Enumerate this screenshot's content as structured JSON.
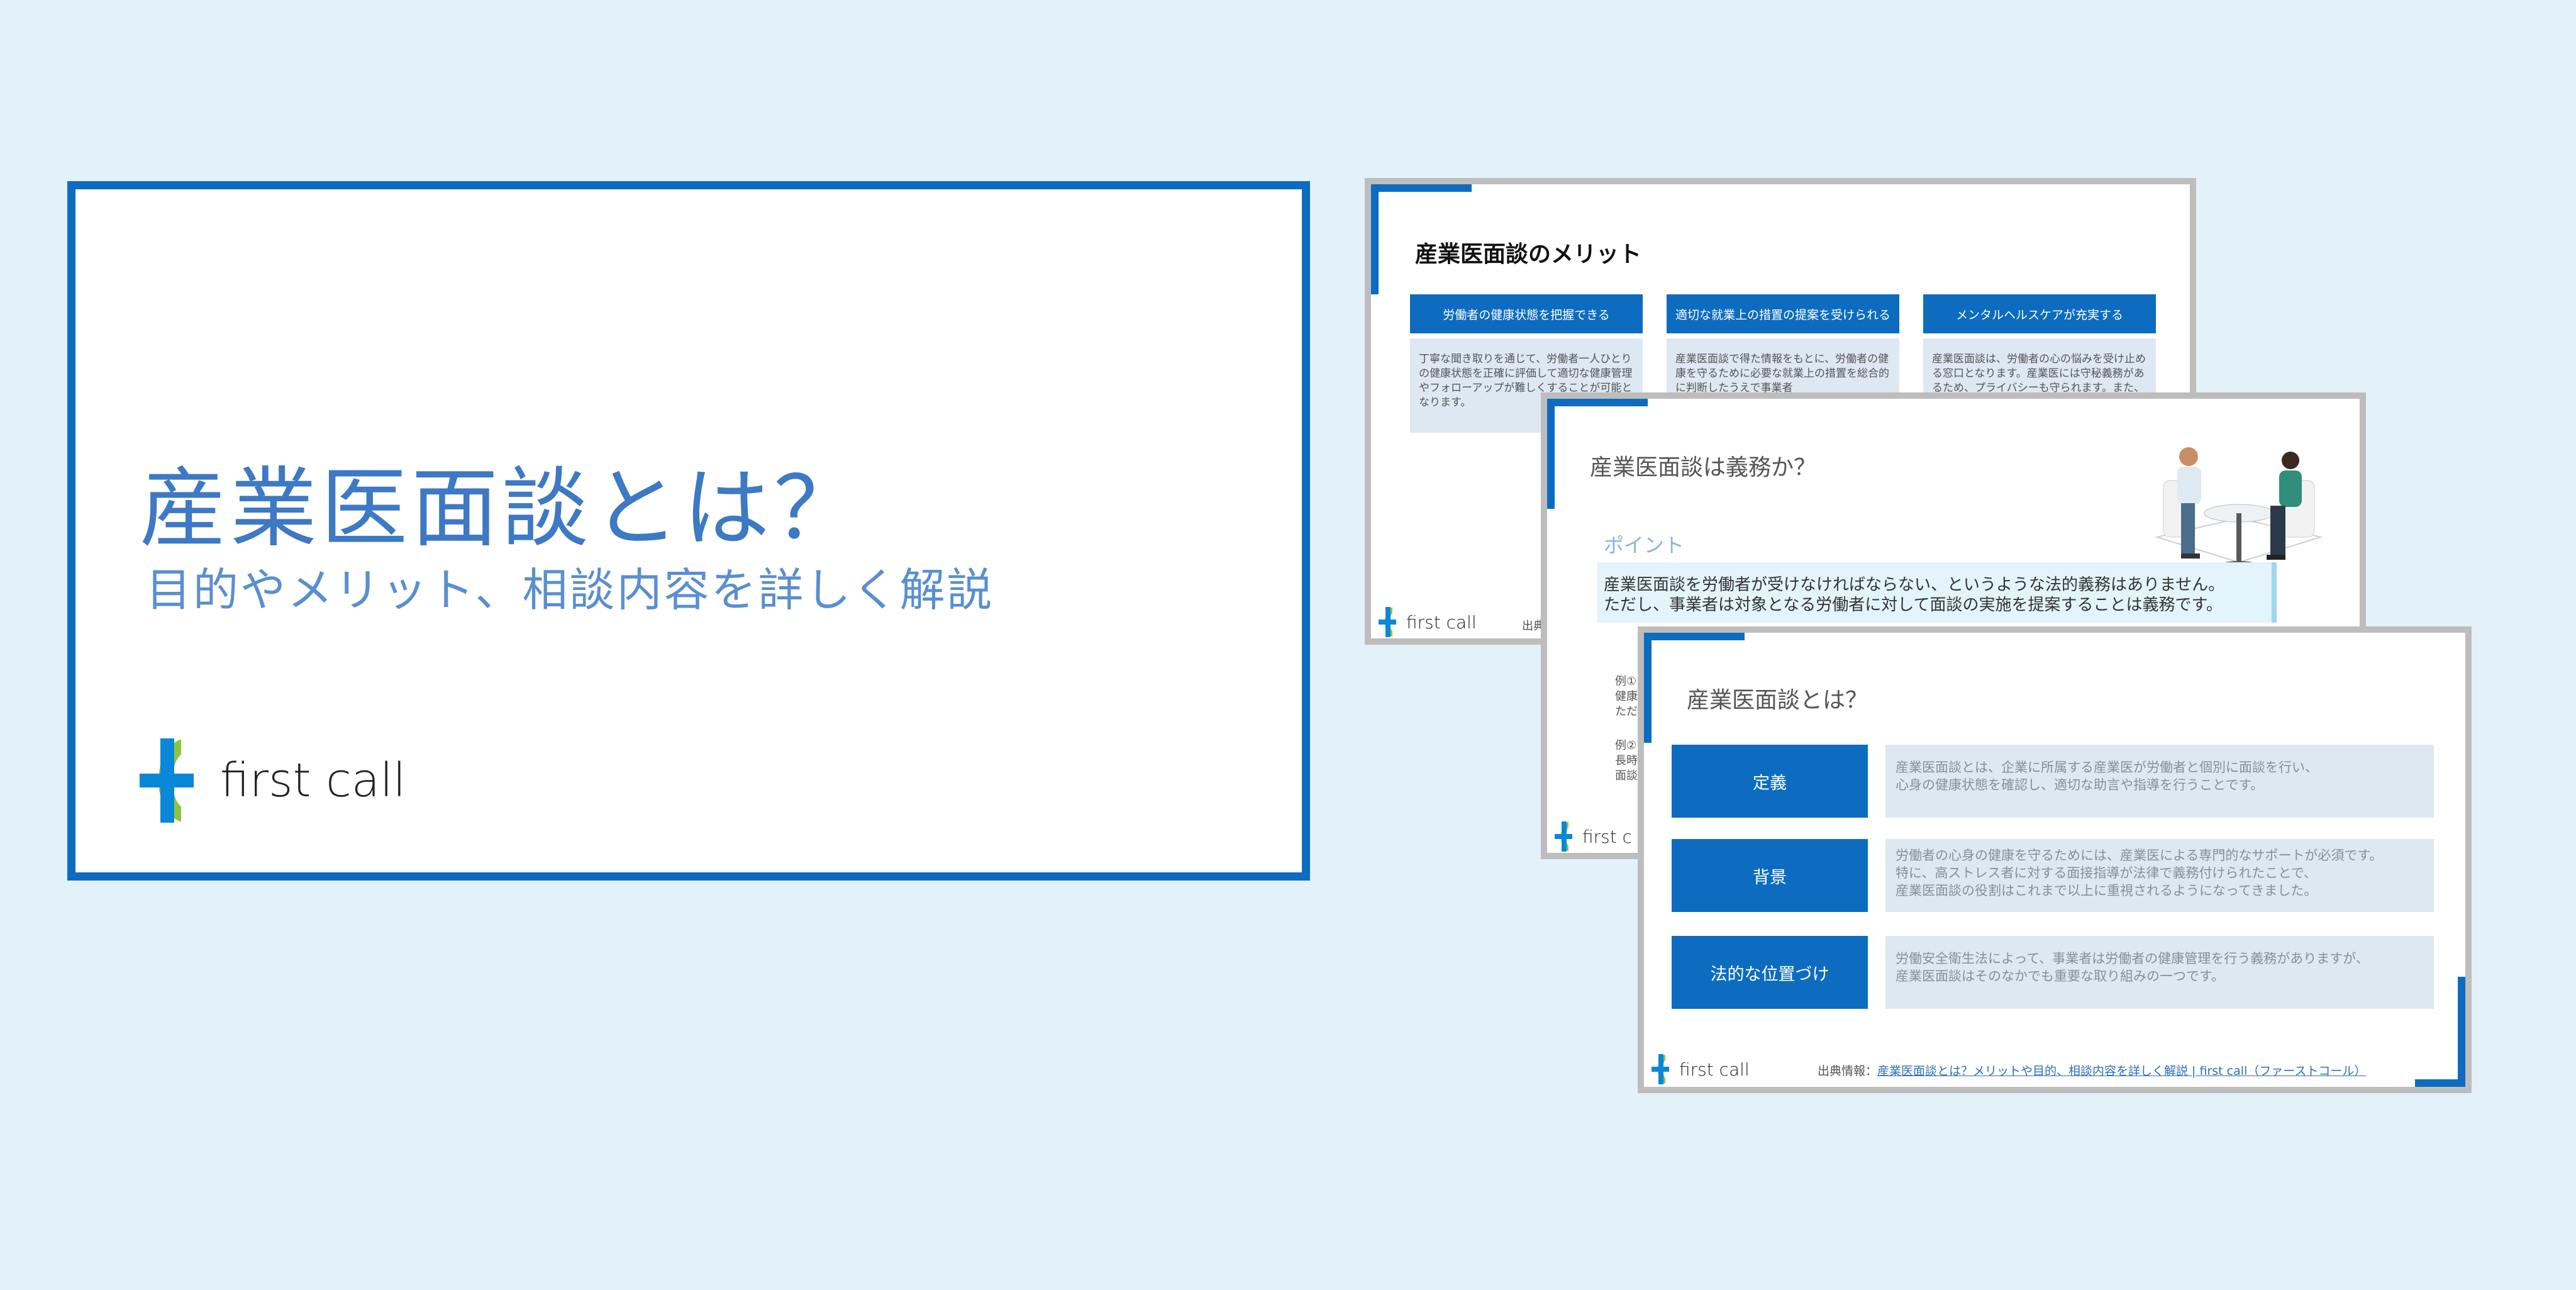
{
  "cover": {
    "title": "産業医面談とは？",
    "subtitle": "目的やメリット、相談内容を詳しく解説",
    "logo_text": "first call"
  },
  "slide_merits": {
    "title": "産業医面談のメリット",
    "columns": [
      {
        "head": "労働者の健康状態を把握できる",
        "body": "丁寧な聞き取りを通じて、労働者一人ひとりの健康状態を正確に評価して適切な健康管理やフォローアップが難しくすることが可能となります。"
      },
      {
        "head": "適切な就業上の措置の提案を受けられる",
        "body": "産業医面談で得た情報をもとに、労働者の健康を守るために必要な就業上の措置を総合的に判断したうえで事業者"
      },
      {
        "head": "メンタルヘルスケアが充実する",
        "body": "産業医面談は、労働者の心の悩みを受け止める窓口となります。産業医には守秘義務があるため、プライバシーも守られます。また、社内の上司や同僚"
      }
    ],
    "logo_text": "first call",
    "source_fragment": "出典"
  },
  "slide_duty": {
    "title": "産業医面談は義務か？",
    "point_label": "ポイント",
    "point_lines": [
      "産業医面談を労働者が受けなければならない、というような法的義務はありません。",
      "ただし、事業者は対象となる労働者に対して面談の実施を提案することは義務です。"
    ],
    "examples": [
      "例①",
      "健康",
      "ただ",
      "例②",
      "長時",
      "面談"
    ],
    "logo_text": "first c"
  },
  "slide_definition": {
    "title": "産業医面談とは？",
    "rows": [
      {
        "label": "定義",
        "lines": [
          "産業医面談とは、企業に所属する産業医が労働者と個別に面談を行い、",
          "心身の健康状態を確認し、適切な助言や指導を行うことです。"
        ]
      },
      {
        "label": "背景",
        "lines": [
          "労働者の心身の健康を守るためには、産業医による専門的なサポートが必須です。",
          "特に、高ストレス者に対する面接指導が法律で義務付けられたことで、",
          "産業医面談の役割はこれまで以上に重視されるようになってきました。"
        ]
      },
      {
        "label": "法的な位置づけ",
        "lines": [
          "労働安全衛生法によって、事業者は労働者の健康管理を行う義務がありますが、",
          "産業医面談はそのなかでも重要な取り組みの一つです。"
        ]
      }
    ],
    "logo_text": "first call",
    "source_label": "出典情報：",
    "source_link": "産業医面談とは？メリットや目的、相談内容を詳しく解説 | first call（ファーストコール）"
  },
  "colors": {
    "background": "#e3f1f9",
    "brand_blue": "#0d6cbf",
    "title_blue": "#3d79c4",
    "logo_green": "#8cc63f",
    "logo_blue": "#0a87d6"
  }
}
